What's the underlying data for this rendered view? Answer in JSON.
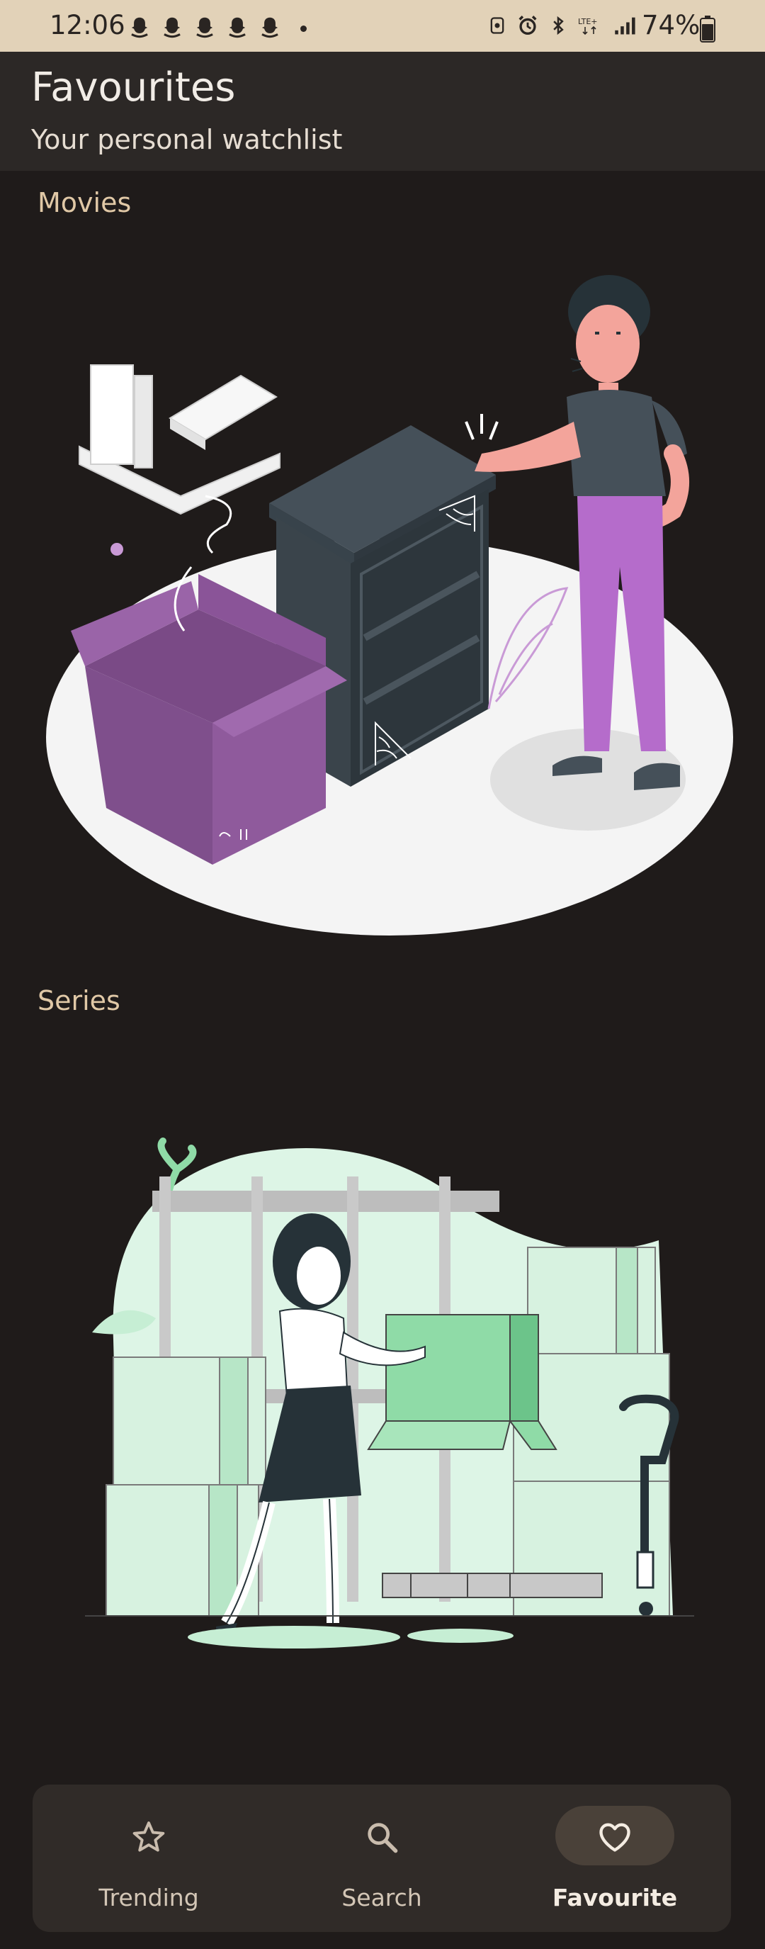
{
  "status_bar": {
    "time": "12:06",
    "battery": "74%",
    "network": "LTE+",
    "notification_icons": [
      "snapchat-icon",
      "snapchat-icon",
      "snapchat-icon",
      "snapchat-icon",
      "snapchat-icon"
    ]
  },
  "header": {
    "title": "Favourites",
    "subtitle": "Your personal watchlist"
  },
  "sections": {
    "movies": {
      "label": "Movies",
      "empty_state": "empty-moving-boxes-illustration"
    },
    "series": {
      "label": "Series",
      "empty_state": "warehouse-woman-box-illustration"
    }
  },
  "bottom_nav": {
    "items": [
      {
        "label": "Trending",
        "icon": "star-icon",
        "active": false
      },
      {
        "label": "Search",
        "icon": "search-icon",
        "active": false
      },
      {
        "label": "Favourite",
        "icon": "heart-icon",
        "active": true
      }
    ]
  },
  "colors": {
    "background": "#1f1b1a",
    "header": "#2c2826",
    "status_bar": "#e2d2b8",
    "section_label": "#e0c8a6",
    "nav_active_pill": "#4a4139"
  }
}
